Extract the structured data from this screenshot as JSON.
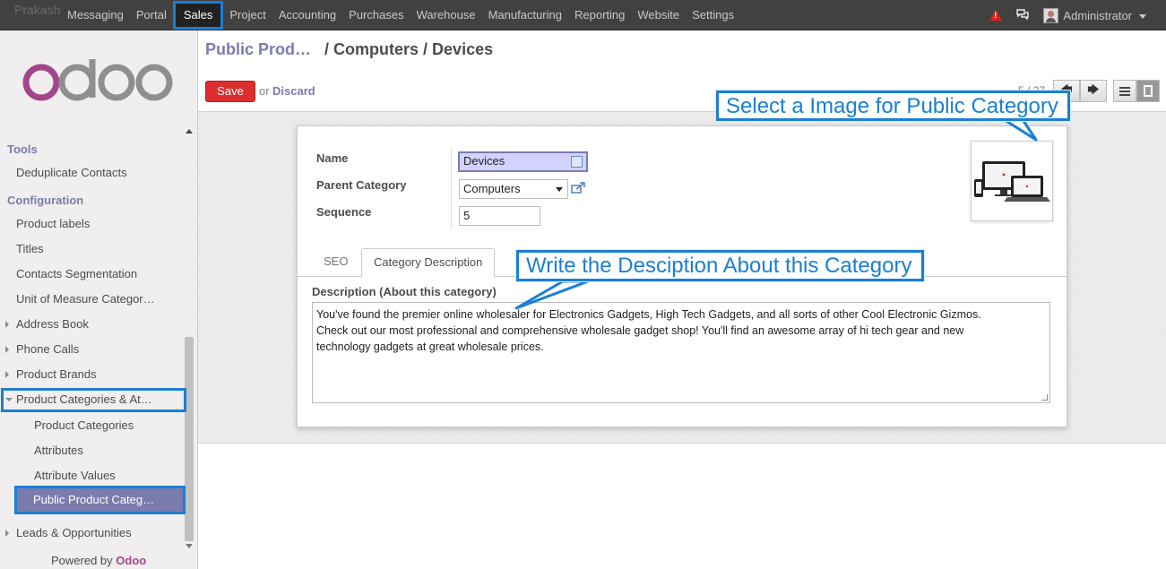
{
  "topbar": {
    "ghost_text": "Prakash",
    "menu": [
      "Messaging",
      "Portal",
      "Sales",
      "Project",
      "Accounting",
      "Purchases",
      "Warehouse",
      "Manufacturing",
      "Reporting",
      "Website",
      "Settings"
    ],
    "active_menu": "Sales",
    "user": "Administrator",
    "icons": [
      "warning-icon",
      "chat-icon",
      "avatar",
      "chevron-down-icon"
    ]
  },
  "sidebar": {
    "logo": "odoo",
    "sections": [
      {
        "title": "Tools",
        "items": [
          "Deduplicate Contacts"
        ]
      },
      {
        "title": "Configuration",
        "items": [
          "Product labels",
          "Titles",
          "Contacts Segmentation",
          "Unit of Measure Categor…"
        ]
      }
    ],
    "groups": [
      "Address Book",
      "Phone Calls",
      "Product Brands",
      "Product Categories & At…",
      "Leads & Opportunities"
    ],
    "subitems": [
      "Product Categories",
      "Attributes",
      "Attribute Values",
      "Public Product Categ…"
    ],
    "active_item": "Public Product Categ…",
    "powered_prefix": "Powered by",
    "powered_brand": "Odoo"
  },
  "header": {
    "breadcrumb_link": "Public Prod…",
    "breadcrumb_current": "/ Computers / Devices",
    "save_label": "Save",
    "or_label": "or",
    "discard_label": "Discard",
    "pager": "5 / 27"
  },
  "form": {
    "name_label": "Name",
    "name_value": "Devices",
    "parent_label": "Parent Category",
    "parent_value": "Computers",
    "sequence_label": "Sequence",
    "sequence_value": "5",
    "tabs": [
      "SEO",
      "Category Description"
    ],
    "active_tab": "Category Description",
    "description_label": "Description (About this category)",
    "description_lines": [
      "You've found the premier online wholesaler for Electronics Gadgets, High Tech Gadgets, and all sorts of other Cool  Electronic Gizmos.",
      "Check out our  most professional and comprehensive wholesale gadget shop! You'll find an awesome array of hi tech gear and new",
      "technology gadgets at great wholesale prices."
    ]
  },
  "callouts": {
    "image_tip": "Select a Image for Public Category",
    "description_tip": "Write the Desciption About this Category"
  },
  "colors": {
    "topbar": "#414141",
    "accent": "#7c7bad",
    "save": "#dc2e2e",
    "highlight": "#1a7fd4",
    "odoo_brand": "#a24689"
  }
}
